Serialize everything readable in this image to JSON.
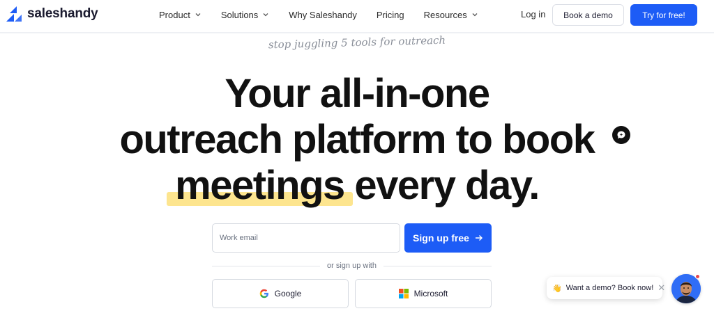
{
  "brand": {
    "name": "saleshandy",
    "accent": "#1d5cf6",
    "highlight": "#fde58f"
  },
  "nav": {
    "items": [
      {
        "label": "Product",
        "dropdown": true
      },
      {
        "label": "Solutions",
        "dropdown": true
      },
      {
        "label": "Why Saleshandy",
        "dropdown": false
      },
      {
        "label": "Pricing",
        "dropdown": false
      },
      {
        "label": "Resources",
        "dropdown": true
      }
    ],
    "login": "Log in",
    "book_demo": "Book a demo",
    "try_free": "Try for free!"
  },
  "hero": {
    "tagline": "stop juggling 5 tools for outreach",
    "headline_line1": "Your all-in-one",
    "headline_line2": "outreach platform to book",
    "headline_highlight": "meetings",
    "headline_line3_rest": " every day."
  },
  "form": {
    "email_placeholder": "Work email",
    "email_value": "",
    "signup_label": "Sign up free",
    "or_text": "or sign up with",
    "google_label": "Google",
    "microsoft_label": "Microsoft"
  },
  "chat": {
    "bubble_text": "Want a demo? Book now!",
    "icons": [
      "wave-icon",
      "close-icon",
      "chat-icon"
    ]
  }
}
